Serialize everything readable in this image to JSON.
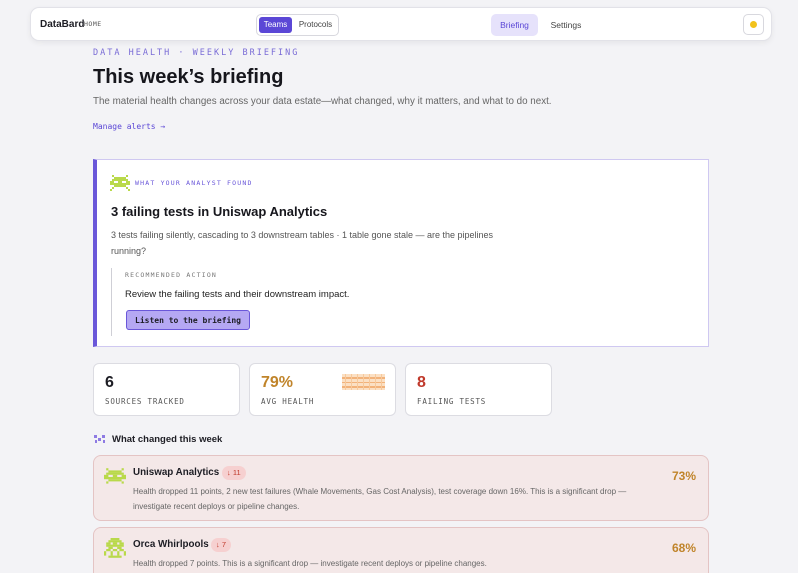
{
  "nav": {
    "brand": "DataBard",
    "brand_sub": "HOME",
    "segment": [
      "Teams",
      "Protocols"
    ],
    "links": [
      "Briefing",
      "Settings"
    ]
  },
  "header": {
    "eyebrow": "DATA HEALTH · WEEKLY BRIEFING",
    "title": "This week’s briefing",
    "subtitle": "The material health changes across your data estate—what changed, why it matters, and what to do next.",
    "manage_link": "Manage alerts →"
  },
  "finding": {
    "eyebrow": "WHAT YOUR ANALYST FOUND",
    "title": "3 failing tests in Uniswap Analytics",
    "description": "3 tests failing silently, cascading to 3 downstream tables · 1 table gone stale — are the pipelines running?",
    "recommended_label": "RECOMMENDED ACTION",
    "recommended_text": "Review the failing tests and their downstream impact.",
    "button": "Listen to the briefing"
  },
  "stats": [
    {
      "value": "6",
      "label": "SOURCES TRACKED",
      "color": "#1d1d24"
    },
    {
      "value": "79%",
      "label": "AVG HEALTH",
      "color": "#c0842a",
      "health_level": 0.79
    },
    {
      "value": "8",
      "label": "FAILING TESTS",
      "color": "#c0392b"
    }
  ],
  "changes": {
    "title": "What changed this week",
    "items": [
      {
        "name": "Uniswap Analytics",
        "delta": "↓ 11",
        "description": "Health dropped 11 points, 2 new test failures (Whale Movements, Gas Cost Analysis), test coverage down 16%. This is a significant drop — investigate recent deploys or pipeline changes.",
        "health": "73%",
        "icon": "pixel-invader-icon"
      },
      {
        "name": "Orca Whirlpools",
        "delta": "↓ 7",
        "description": "Health dropped 7 points. This is a significant drop — investigate recent deploys or pipeline changes.",
        "health": "68%",
        "icon": "pixel-squid-icon"
      }
    ]
  },
  "colors": {
    "accent": "#5b47d6",
    "warning": "#c0842a",
    "danger": "#c0392b",
    "alert_bg": "#f4e8e8"
  }
}
